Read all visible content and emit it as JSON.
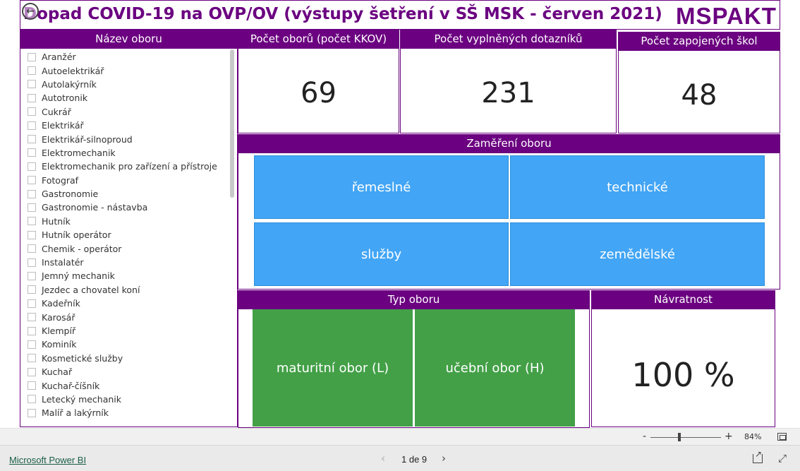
{
  "header": {
    "title": "Dopad COVID-19 na OVP/OV (výstupy šetření v SŠ MSK - červen 2021)",
    "logo_text": "MSPAKT"
  },
  "colors": {
    "header_purple": "#6b0080",
    "tile_blue": "#42a5f5",
    "tile_green": "#43a047"
  },
  "slicer": {
    "heading": "Název oboru",
    "items": [
      "Aranžér",
      "Autoelektrikář",
      "Autolakýrník",
      "Autotronik",
      "Cukrář",
      "Elektrikář",
      "Elektrikář-silnoproud",
      "Elektromechanik",
      "Elektromechanik pro zařízení a přístroje",
      "Fotograf",
      "Gastronomie",
      "Gastronomie - nástavba",
      "Hutník",
      "Hutník operátor",
      "Chemik - operátor",
      "Instalatér",
      "Jemný mechanik",
      "Jezdec a chovatel koní",
      "Kadeřník",
      "Karosář",
      "Klempíř",
      "Kominík",
      "Kosmetické služby",
      "Kuchař",
      "Kuchař-číšník",
      "Letecký mechanik",
      "Malíř a lakýrník"
    ]
  },
  "kpis": {
    "obory": {
      "label": "Počet oborů (počet KKOV)",
      "value": "69"
    },
    "dotazniky": {
      "label": "Počet vyplněných dotazníků",
      "value": "231"
    },
    "skoly": {
      "label": "Počet zapojených škol",
      "value": "48"
    },
    "navratnost": {
      "label": "Návratnost",
      "value": "100 %"
    }
  },
  "zamereni": {
    "heading": "Zaměření oboru",
    "tiles": [
      "řemeslné",
      "technické",
      "služby",
      "zemědělské"
    ]
  },
  "typ": {
    "heading": "Typ oboru",
    "tiles": [
      "maturitní obor (L)",
      "učební obor (H)"
    ]
  },
  "zoom": {
    "minus": "-",
    "plus": "+",
    "level": "84%"
  },
  "footer": {
    "brand": "Microsoft Power BI",
    "pager": "1 de 9",
    "prev": "‹",
    "next": "›"
  }
}
